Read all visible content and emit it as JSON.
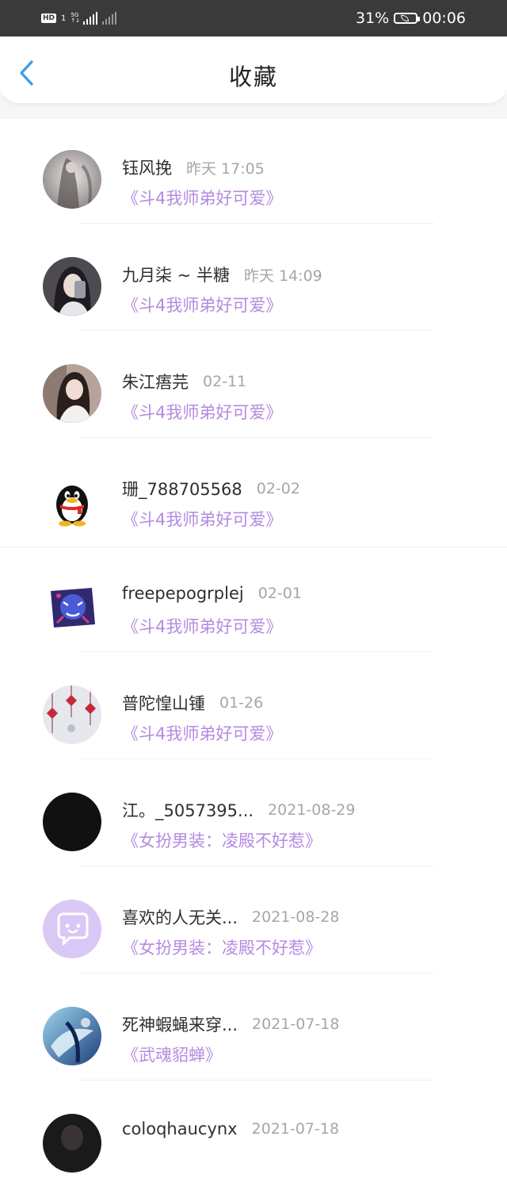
{
  "status_bar": {
    "hd_label": "HD",
    "sim_label": "1",
    "net_label": "5G",
    "battery": "31%",
    "time": "00:06"
  },
  "header": {
    "back_icon": "chevron-left-icon",
    "title": "收藏"
  },
  "favorites": [
    {
      "user": "钰风挽",
      "time": "昨天 17:05",
      "book": "《斗4我师弟好可爱》",
      "avatar": "photo-misty-figure"
    },
    {
      "user": "九月柒 ~ 半糖",
      "time": "昨天 14:09",
      "book": "《斗4我师弟好可爱》",
      "avatar": "photo-selfie-girl"
    },
    {
      "user": "朱江痦芫",
      "time": "02-11",
      "book": "《斗4我师弟好可爱》",
      "avatar": "photo-girl-long-hair"
    },
    {
      "user": "珊_788705568",
      "time": "02-02",
      "book": "《斗4我师弟好可爱》",
      "avatar": "qq-penguin-icon"
    },
    {
      "user": "freepepogrplej",
      "time": "02-01",
      "book": "《斗4我师弟好可爱》",
      "avatar": "blue-dragon-badge"
    },
    {
      "user": "普陀惶山锺",
      "time": "01-26",
      "book": "《斗4我师弟好可爱》",
      "avatar": "photo-chinese-knots"
    },
    {
      "user": "江。_5057395...",
      "time": "2021-08-29",
      "book": "《女扮男装：凌殿不好惹》",
      "avatar": "black-circle"
    },
    {
      "user": "喜欢的人无关...",
      "time": "2021-08-28",
      "book": "《女扮男装：凌殿不好惹》",
      "avatar": "chat-bubble-icon"
    },
    {
      "user": "死神蝦蝇来穿...",
      "time": "2021-07-18",
      "book": "《武魂貂蝉》",
      "avatar": "blue-anime-illustration"
    },
    {
      "user": "coloqhaucynx",
      "time": "2021-07-18",
      "book": "",
      "avatar": "photo-dark-partial"
    }
  ],
  "colors": {
    "status_bar_bg": "#3a3a3a",
    "back_arrow": "#3a9ee6",
    "book_title": "#b48be0",
    "time_text": "#a6a6a6",
    "chat_avatar_bg": "#d9c8f5"
  }
}
